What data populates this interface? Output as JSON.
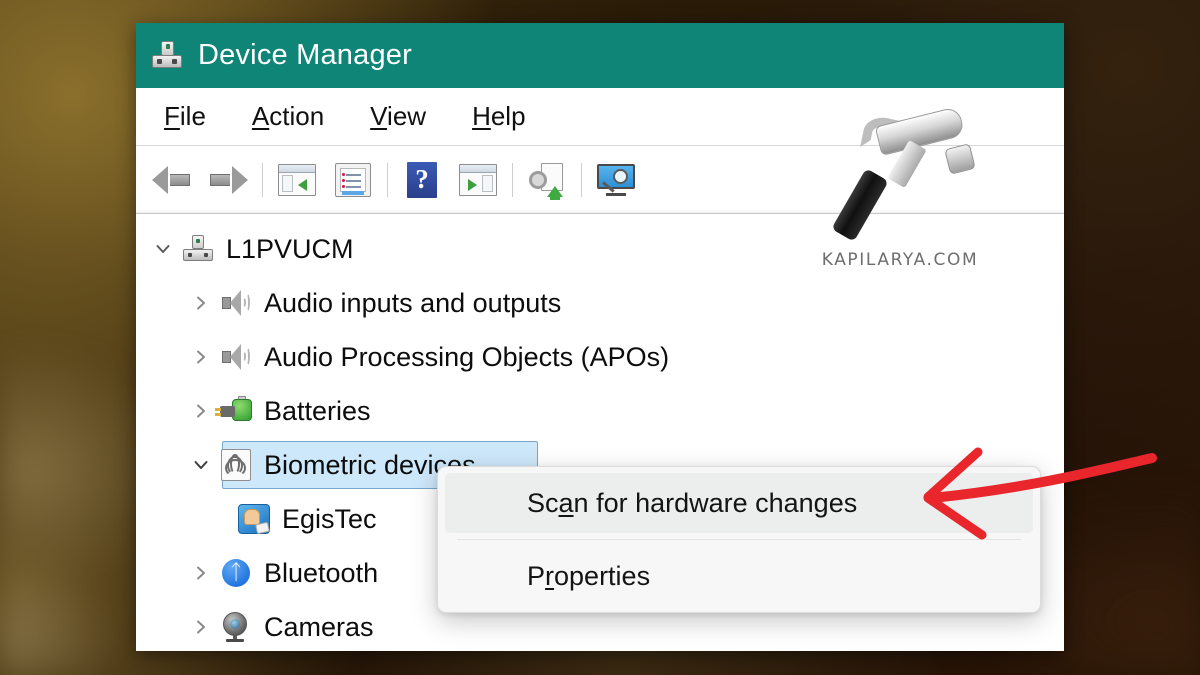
{
  "window": {
    "title": "Device Manager",
    "app_icon": "device-manager-icon"
  },
  "menu_bar": {
    "items": [
      {
        "label": "File",
        "accesskey": "F",
        "rest": "ile"
      },
      {
        "label": "Action",
        "accesskey": "A",
        "rest": "ction"
      },
      {
        "label": "View",
        "accesskey": "V",
        "rest": "iew"
      },
      {
        "label": "Help",
        "accesskey": "H",
        "rest": "elp"
      }
    ]
  },
  "toolbar": {
    "buttons": [
      {
        "icon": "back-arrow-icon",
        "tooltip": "Back"
      },
      {
        "icon": "forward-arrow-icon",
        "tooltip": "Forward"
      },
      {
        "icon": "show-hide-console-tree-icon",
        "tooltip": "Show/Hide Console Tree"
      },
      {
        "icon": "properties-icon",
        "tooltip": "Properties"
      },
      {
        "icon": "help-icon",
        "tooltip": "Help"
      },
      {
        "icon": "show-hide-action-pane-icon",
        "tooltip": "Show/Hide Action Pane"
      },
      {
        "icon": "update-driver-icon",
        "tooltip": "Update driver"
      },
      {
        "icon": "scan-for-hardware-changes-icon",
        "tooltip": "Scan for hardware changes"
      }
    ]
  },
  "tree": {
    "nodes": [
      {
        "label": "L1PVUCM",
        "icon": "computer-icon",
        "depth": 0,
        "state": "expanded",
        "selected": false
      },
      {
        "label": "Audio inputs and outputs",
        "icon": "speaker-icon",
        "depth": 1,
        "state": "collapsed",
        "selected": false
      },
      {
        "label": "Audio Processing Objects (APOs)",
        "icon": "speaker-icon",
        "depth": 1,
        "state": "collapsed",
        "selected": false
      },
      {
        "label": "Batteries",
        "icon": "battery-icon",
        "depth": 1,
        "state": "collapsed",
        "selected": false
      },
      {
        "label": "Biometric devices",
        "icon": "fingerprint-icon",
        "depth": 1,
        "state": "expanded",
        "selected": true
      },
      {
        "label": "EgisTec",
        "icon": "egistec-icon",
        "depth": 2,
        "state": "leaf",
        "selected": false
      },
      {
        "label": "Bluetooth",
        "icon": "bluetooth-icon",
        "depth": 1,
        "state": "collapsed",
        "selected": false
      },
      {
        "label": "Cameras",
        "icon": "camera-icon",
        "depth": 1,
        "state": "collapsed",
        "selected": false
      }
    ]
  },
  "context_menu": {
    "items": [
      {
        "pre": "Sc",
        "accesskey": "a",
        "post": "n for hardware changes",
        "highlighted": true
      },
      {
        "pre": "P",
        "accesskey": "r",
        "post": "operties",
        "highlighted": false
      }
    ]
  },
  "watermark": {
    "text": "KAPILARYA.COM",
    "icon": "hammer-icon"
  },
  "annotation": {
    "arrow_color": "#e8262c",
    "points_to": "Scan for hardware changes"
  },
  "colors": {
    "title_bar": "#0f8577",
    "selection_fill": "#cde8fa",
    "selection_border": "#7aa7c7",
    "menu_highlight": "#eceded",
    "arrow_red": "#e8262c"
  }
}
